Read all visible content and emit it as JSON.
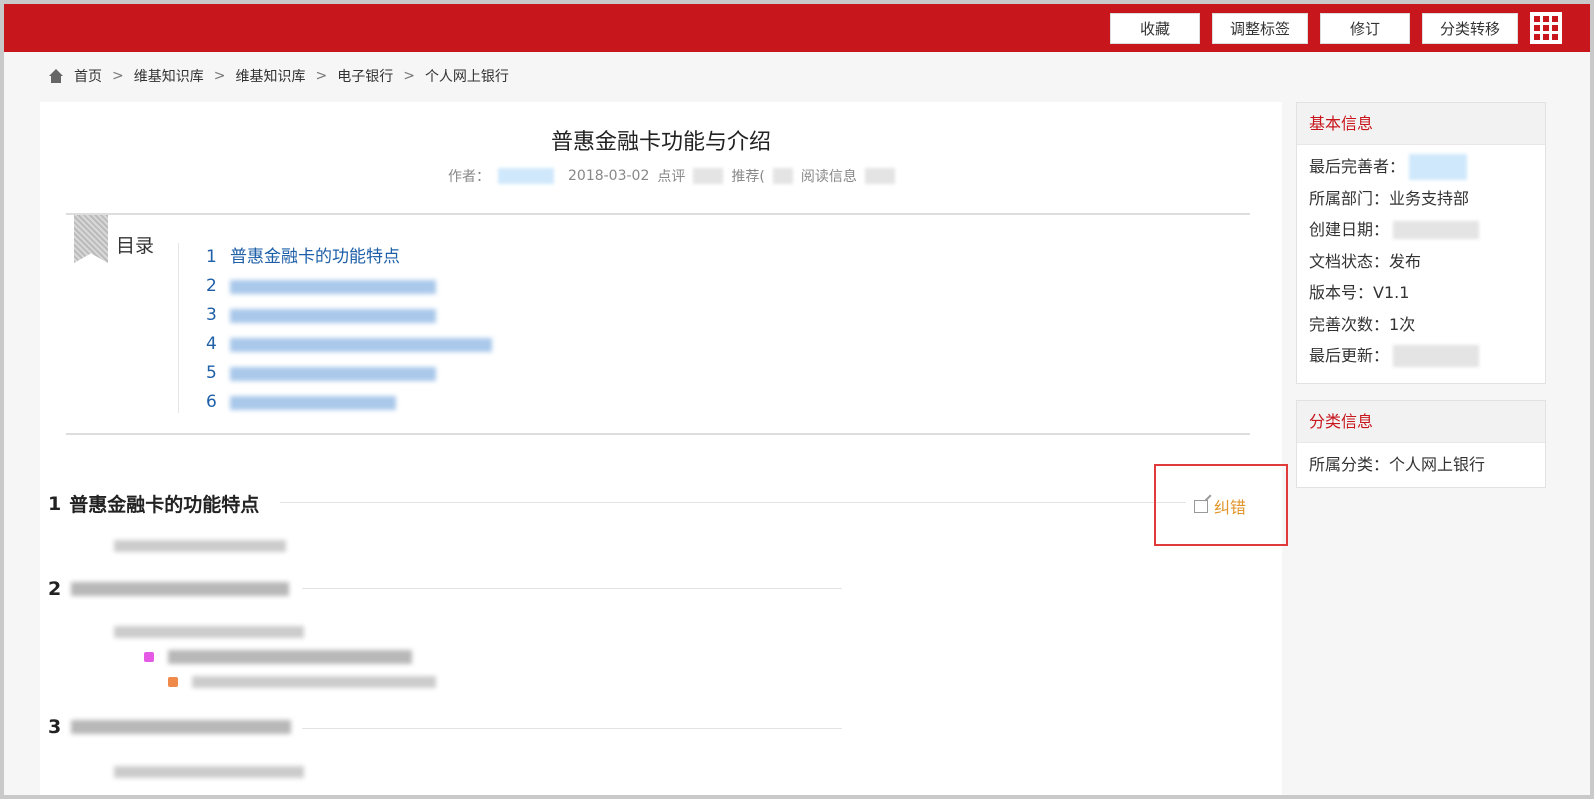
{
  "toolbar": {
    "buttons": [
      "收藏",
      "调整标签",
      "修订",
      "分类转移"
    ],
    "apps_icon": "grid-icon"
  },
  "breadcrumb": {
    "home": "首页",
    "items": [
      "维基知识库",
      "维基知识库",
      "电子银行",
      "个人网上银行"
    ],
    "separator": ">"
  },
  "article": {
    "title": "普惠金融卡功能与介绍",
    "author_label": "作者：",
    "date": "2018-03-02",
    "views_label": "点评",
    "recommend_label": "推荐(",
    "read_label": "阅读信息"
  },
  "toc": {
    "label": "目录",
    "items": [
      {
        "num": "1",
        "text": "普惠金融卡的功能特点"
      },
      {
        "num": "2",
        "text": ""
      },
      {
        "num": "3",
        "text": ""
      },
      {
        "num": "4",
        "text": ""
      },
      {
        "num": "5",
        "text": ""
      },
      {
        "num": "6",
        "text": ""
      }
    ]
  },
  "sections": [
    {
      "num": "1",
      "title": "普惠金融卡的功能特点"
    },
    {
      "num": "2",
      "title": ""
    },
    {
      "num": "3",
      "title": ""
    }
  ],
  "report": {
    "label": "纠错",
    "icon": "edit-icon",
    "color": "#e0962a"
  },
  "basic_info": {
    "heading": "基本信息",
    "last_editor_label": "最后完善者：",
    "department_label": "所属部门：",
    "department": "业务支持部",
    "created_label": "创建日期：",
    "status_label": "文档状态：",
    "status": "发布",
    "version_label": "版本号：",
    "version": "V1.1",
    "edit_count_label": "完善次数：",
    "edit_count": "1次",
    "last_update_label": "最后更新："
  },
  "category_info": {
    "heading": "分类信息",
    "category_label": "所属分类：",
    "category": "个人网上银行"
  },
  "colors": {
    "brand": "#c8161d",
    "link": "#1e5fa8",
    "highlight_box": "#e03a3a"
  }
}
